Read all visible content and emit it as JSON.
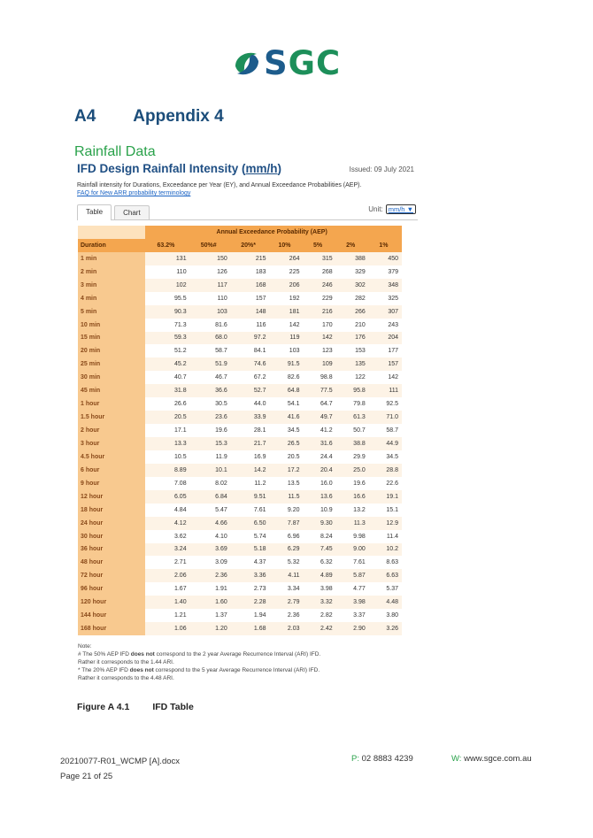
{
  "logo": {
    "text_s": "S",
    "text_gc": "GC"
  },
  "heading": {
    "number": "A4",
    "title": "Appendix 4"
  },
  "section_title": "Rainfall Data",
  "ifd": {
    "title_prefix": "IFD Design Rainfall Intensity (",
    "title_unit": "mm/h",
    "title_suffix": ")",
    "issued": "Issued: 09 July 2021",
    "description": "Rainfall intensity for Durations, Exceedance per Year (EY), and Annual Exceedance Probabilities (AEP).",
    "faq_link": "FAQ for New ARR probability terminology",
    "tabs": [
      "Table",
      "Chart"
    ],
    "unit_label": "Unit:",
    "unit_value": "mm/h"
  },
  "table": {
    "group_header": "Annual Exceedance Probability (AEP)",
    "duration_header": "Duration",
    "columns": [
      "63.2%",
      "50%#",
      "20%*",
      "10%",
      "5%",
      "2%",
      "1%"
    ],
    "rows": [
      {
        "d": "1 min",
        "v": [
          "131",
          "150",
          "215",
          "264",
          "315",
          "388",
          "450"
        ]
      },
      {
        "d": "2 min",
        "v": [
          "110",
          "126",
          "183",
          "225",
          "268",
          "329",
          "379"
        ]
      },
      {
        "d": "3 min",
        "v": [
          "102",
          "117",
          "168",
          "206",
          "246",
          "302",
          "348"
        ]
      },
      {
        "d": "4 min",
        "v": [
          "95.5",
          "110",
          "157",
          "192",
          "229",
          "282",
          "325"
        ]
      },
      {
        "d": "5 min",
        "v": [
          "90.3",
          "103",
          "148",
          "181",
          "216",
          "266",
          "307"
        ]
      },
      {
        "d": "10 min",
        "v": [
          "71.3",
          "81.6",
          "116",
          "142",
          "170",
          "210",
          "243"
        ]
      },
      {
        "d": "15 min",
        "v": [
          "59.3",
          "68.0",
          "97.2",
          "119",
          "142",
          "176",
          "204"
        ]
      },
      {
        "d": "20 min",
        "v": [
          "51.2",
          "58.7",
          "84.1",
          "103",
          "123",
          "153",
          "177"
        ]
      },
      {
        "d": "25 min",
        "v": [
          "45.2",
          "51.9",
          "74.6",
          "91.5",
          "109",
          "135",
          "157"
        ]
      },
      {
        "d": "30 min",
        "v": [
          "40.7",
          "46.7",
          "67.2",
          "82.6",
          "98.8",
          "122",
          "142"
        ]
      },
      {
        "d": "45 min",
        "v": [
          "31.8",
          "36.6",
          "52.7",
          "64.8",
          "77.5",
          "95.8",
          "111"
        ]
      },
      {
        "d": "1 hour",
        "v": [
          "26.6",
          "30.5",
          "44.0",
          "54.1",
          "64.7",
          "79.8",
          "92.5"
        ]
      },
      {
        "d": "1.5 hour",
        "v": [
          "20.5",
          "23.6",
          "33.9",
          "41.6",
          "49.7",
          "61.3",
          "71.0"
        ]
      },
      {
        "d": "2 hour",
        "v": [
          "17.1",
          "19.6",
          "28.1",
          "34.5",
          "41.2",
          "50.7",
          "58.7"
        ]
      },
      {
        "d": "3 hour",
        "v": [
          "13.3",
          "15.3",
          "21.7",
          "26.5",
          "31.6",
          "38.8",
          "44.9"
        ]
      },
      {
        "d": "4.5 hour",
        "v": [
          "10.5",
          "11.9",
          "16.9",
          "20.5",
          "24.4",
          "29.9",
          "34.5"
        ]
      },
      {
        "d": "6 hour",
        "v": [
          "8.89",
          "10.1",
          "14.2",
          "17.2",
          "20.4",
          "25.0",
          "28.8"
        ]
      },
      {
        "d": "9 hour",
        "v": [
          "7.08",
          "8.02",
          "11.2",
          "13.5",
          "16.0",
          "19.6",
          "22.6"
        ]
      },
      {
        "d": "12 hour",
        "v": [
          "6.05",
          "6.84",
          "9.51",
          "11.5",
          "13.6",
          "16.6",
          "19.1"
        ]
      },
      {
        "d": "18 hour",
        "v": [
          "4.84",
          "5.47",
          "7.61",
          "9.20",
          "10.9",
          "13.2",
          "15.1"
        ]
      },
      {
        "d": "24 hour",
        "v": [
          "4.12",
          "4.66",
          "6.50",
          "7.87",
          "9.30",
          "11.3",
          "12.9"
        ]
      },
      {
        "d": "30 hour",
        "v": [
          "3.62",
          "4.10",
          "5.74",
          "6.96",
          "8.24",
          "9.98",
          "11.4"
        ]
      },
      {
        "d": "36 hour",
        "v": [
          "3.24",
          "3.69",
          "5.18",
          "6.29",
          "7.45",
          "9.00",
          "10.2"
        ]
      },
      {
        "d": "48 hour",
        "v": [
          "2.71",
          "3.09",
          "4.37",
          "5.32",
          "6.32",
          "7.61",
          "8.63"
        ]
      },
      {
        "d": "72 hour",
        "v": [
          "2.06",
          "2.36",
          "3.36",
          "4.11",
          "4.89",
          "5.87",
          "6.63"
        ]
      },
      {
        "d": "96 hour",
        "v": [
          "1.67",
          "1.91",
          "2.73",
          "3.34",
          "3.98",
          "4.77",
          "5.37"
        ]
      },
      {
        "d": "120 hour",
        "v": [
          "1.40",
          "1.60",
          "2.28",
          "2.79",
          "3.32",
          "3.98",
          "4.48"
        ]
      },
      {
        "d": "144 hour",
        "v": [
          "1.21",
          "1.37",
          "1.94",
          "2.36",
          "2.82",
          "3.37",
          "3.80"
        ]
      },
      {
        "d": "168 hour",
        "v": [
          "1.06",
          "1.20",
          "1.68",
          "2.03",
          "2.42",
          "2.90",
          "3.26"
        ]
      }
    ]
  },
  "notes": {
    "heading": "Note:",
    "line1_a": "# The 50% AEP IFD ",
    "line1_b": "does not",
    "line1_c": " correspond to the 2 year Average Recurrence Interval (ARI) IFD.",
    "line2": "Rather it corresponds to the 1.44 ARI.",
    "line3_a": "* The 20% AEP IFD ",
    "line3_b": "does not",
    "line3_c": " correspond to the 5 year Average Recurrence Interval (ARI) IFD.",
    "line4": "Rather it corresponds to the 4.48 ARI."
  },
  "figure": {
    "number": "Figure A 4.1",
    "caption": "IFD Table"
  },
  "footer": {
    "docref": "20210077-R01_WCMP [A].docx",
    "page": "Page 21 of 25",
    "phone_label": "P:",
    "phone": "02 8883 4239",
    "web_label": "W:",
    "web": "www.sgce.com.au"
  }
}
